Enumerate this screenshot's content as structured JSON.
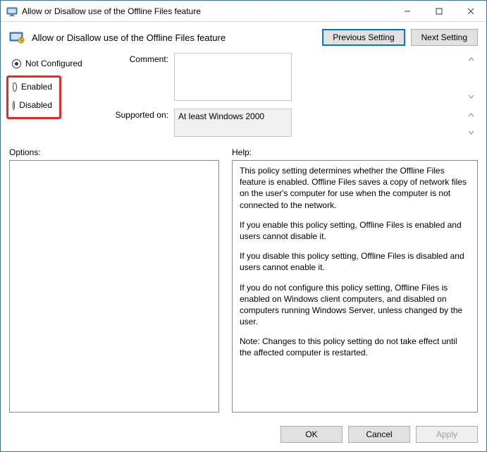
{
  "window": {
    "title": "Allow or Disallow use of the Offline Files feature"
  },
  "header": {
    "title": "Allow or Disallow use of the Offline Files feature",
    "prev_label": "Previous Setting",
    "next_label": "Next Setting"
  },
  "radios": {
    "not_configured": "Not Configured",
    "enabled": "Enabled",
    "disabled": "Disabled",
    "selected": "not_configured"
  },
  "fields": {
    "comment_label": "Comment:",
    "comment_value": "",
    "supported_label": "Supported on:",
    "supported_value": "At least Windows 2000"
  },
  "panels": {
    "options_label": "Options:",
    "help_label": "Help:",
    "options_text": "",
    "help_paragraphs": [
      "This policy setting determines whether the Offline Files feature is enabled. Offline Files saves a copy of network files on the user's computer for use when the computer is not connected to the network.",
      "If you enable this policy setting, Offline Files is enabled and users cannot disable it.",
      "If you disable this policy setting, Offline Files is disabled and users cannot enable it.",
      "If you do not configure this policy setting, Offline Files is enabled on Windows client computers, and disabled on computers running Windows Server, unless changed by the user.",
      "Note: Changes to this policy setting do not take effect until the affected computer is restarted."
    ]
  },
  "footer": {
    "ok": "OK",
    "cancel": "Cancel",
    "apply": "Apply"
  }
}
